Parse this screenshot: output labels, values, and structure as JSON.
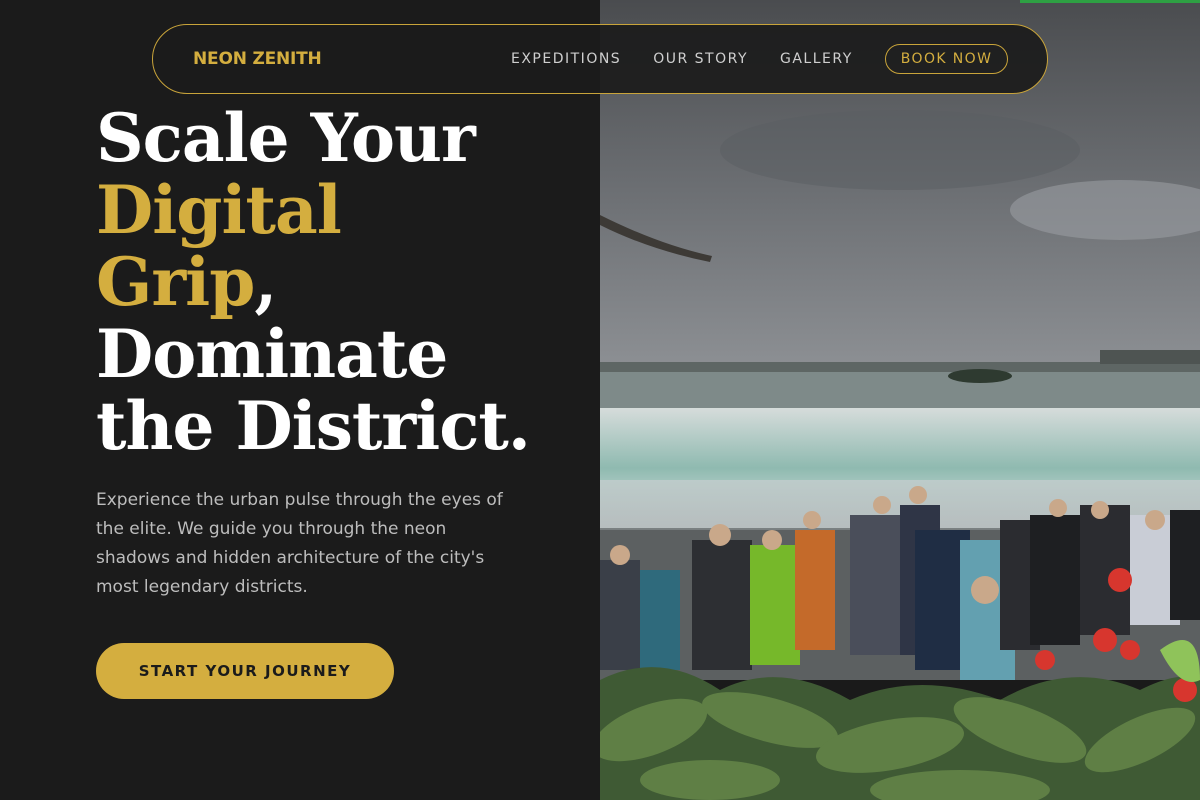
{
  "brand": {
    "name": "NEON ZENITH"
  },
  "nav": {
    "links": [
      "EXPEDITIONS",
      "OUR STORY",
      "GALLERY"
    ],
    "cta_label": "BOOK NOW"
  },
  "hero": {
    "headline": {
      "line1": "Scale Your",
      "line2_gold": "Digital",
      "line3_gold": "Grip",
      "line3_suffix": ",",
      "line4": "Dominate",
      "line5": "the District."
    },
    "description": "Experience the urban pulse through the eyes of the elite. We guide you through the neon shadows and hidden architecture of the city's most legendary districts.",
    "cta_label": "START YOUR JOURNEY"
  },
  "colors": {
    "accent_gold": "#d4ae3f",
    "background_dark": "#1b1b1b",
    "text_light": "#ffffff",
    "text_muted": "#bdbdbd"
  }
}
